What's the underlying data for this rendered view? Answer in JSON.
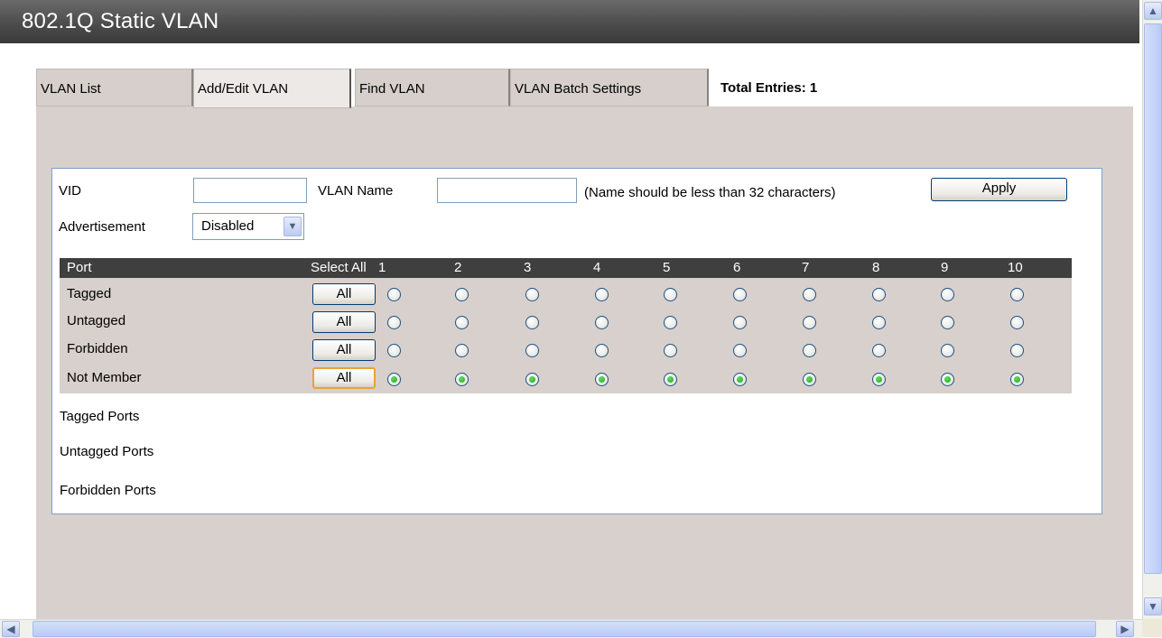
{
  "title": "802.1Q Static VLAN",
  "tabs": [
    {
      "label": "VLAN List"
    },
    {
      "label": "Add/Edit VLAN"
    },
    {
      "label": "Find VLAN"
    },
    {
      "label": "VLAN Batch Settings"
    }
  ],
  "total_entries": "Total Entries: 1",
  "form": {
    "vid_label": "VID",
    "vid_value": "",
    "vlan_name_label": "VLAN Name",
    "vlan_name_value": "",
    "name_hint": "(Name should be less than 32 characters)",
    "apply_label": "Apply",
    "advertisement_label": "Advertisement",
    "advertisement_value": "Disabled"
  },
  "ports": {
    "header_port": "Port",
    "header_select_all": "Select All",
    "port_numbers": [
      "1",
      "2",
      "3",
      "4",
      "5",
      "6",
      "7",
      "8",
      "9",
      "10"
    ],
    "rows": [
      {
        "label": "Tagged",
        "button": "All"
      },
      {
        "label": "Untagged",
        "button": "All"
      },
      {
        "label": "Forbidden",
        "button": "All"
      },
      {
        "label": "Not Member",
        "button": "All"
      }
    ],
    "selected_row": "Not Member"
  },
  "summary": {
    "tagged_ports": "Tagged Ports",
    "untagged_ports": "Untagged Ports",
    "forbidden_ports": "Forbidden Ports"
  },
  "icons": {
    "scroll_up": "chevron-up-icon",
    "scroll_down": "chevron-down-icon",
    "scroll_left": "chevron-left-icon",
    "scroll_right": "chevron-right-icon",
    "dropdown": "chevron-down-icon"
  }
}
